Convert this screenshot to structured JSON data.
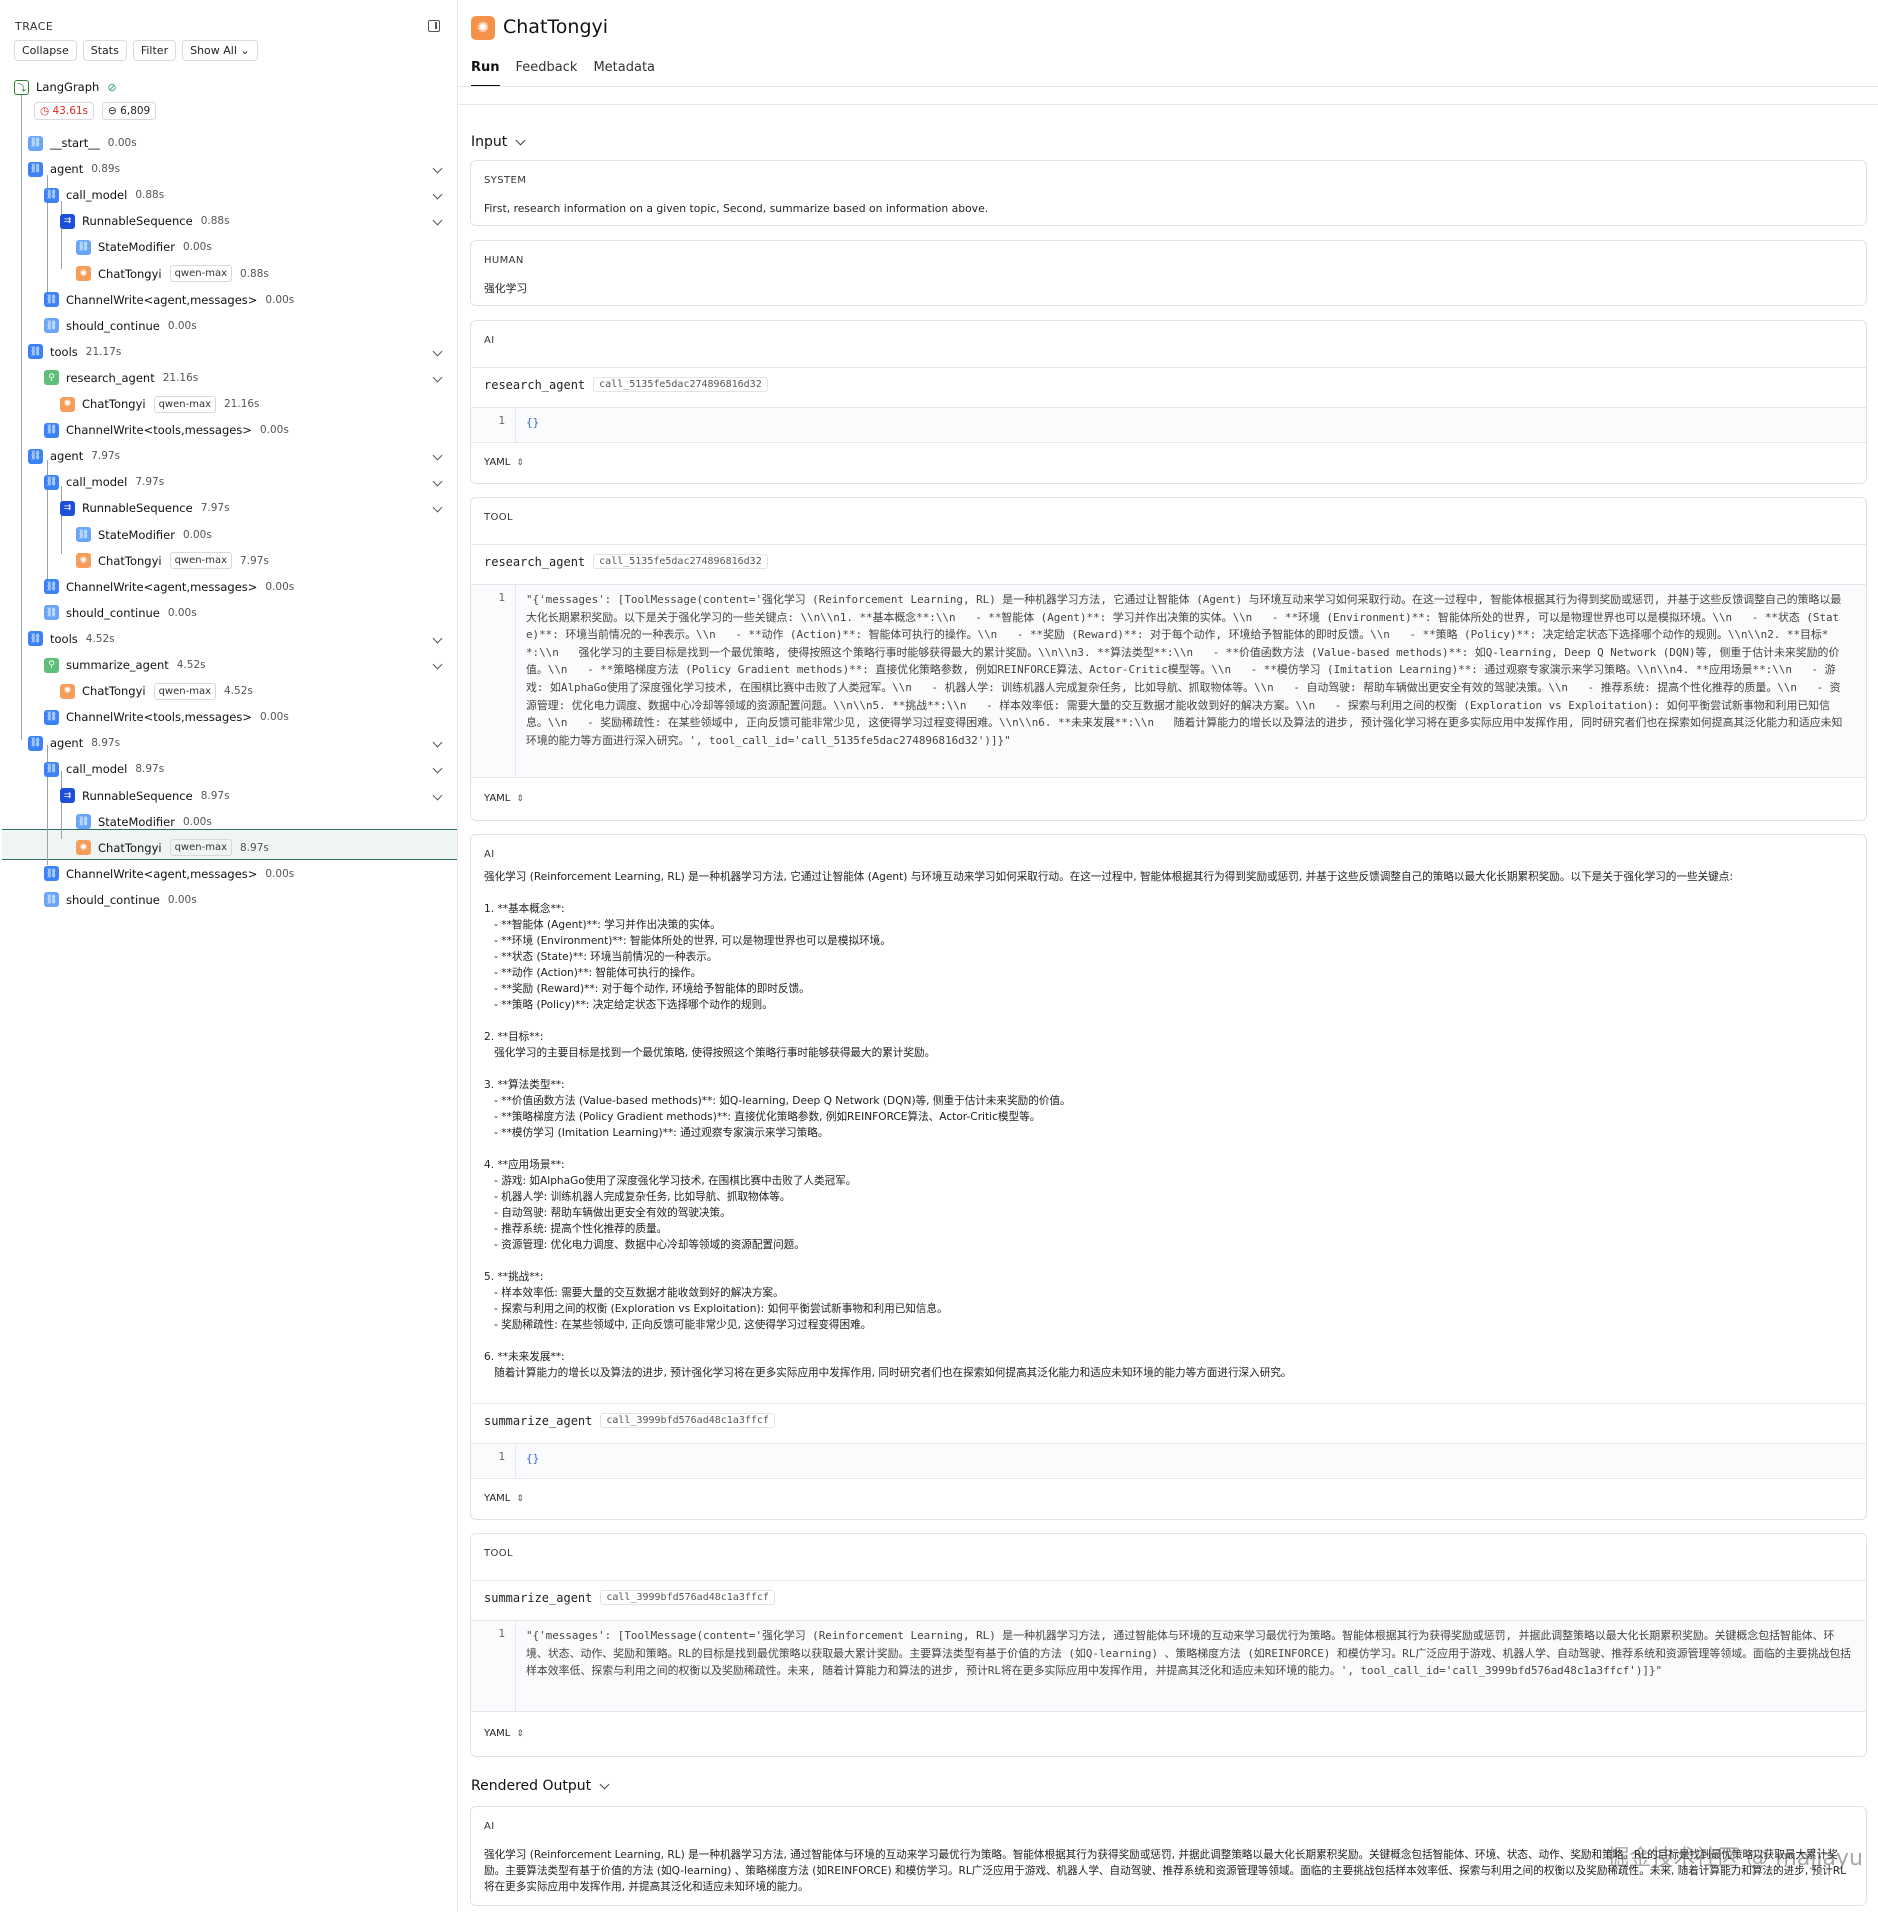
{
  "trace": {
    "header": "TRACE",
    "toolbar": {
      "collapse": "Collapse",
      "stats": "Stats",
      "filter": "Filter",
      "show_all": "Show All"
    },
    "root": {
      "label": "LangGraph",
      "latency": "43.61s",
      "tokens": "6,809"
    },
    "nodes": [
      {
        "label": "__start__",
        "dur": "0.00s"
      },
      {
        "label": "agent",
        "dur": "0.89s"
      },
      {
        "label": "call_model",
        "dur": "0.88s"
      },
      {
        "label": "RunnableSequence",
        "dur": "0.88s"
      },
      {
        "label": "StateModifier",
        "dur": "0.00s"
      },
      {
        "label": "ChatTongyi",
        "tag": "qwen-max",
        "dur": "0.88s"
      },
      {
        "label": "ChannelWrite<agent,messages>",
        "dur": "0.00s"
      },
      {
        "label": "should_continue",
        "dur": "0.00s"
      },
      {
        "label": "tools",
        "dur": "21.17s"
      },
      {
        "label": "research_agent",
        "dur": "21.16s"
      },
      {
        "label": "ChatTongyi",
        "tag": "qwen-max",
        "dur": "21.16s"
      },
      {
        "label": "ChannelWrite<tools,messages>",
        "dur": "0.00s"
      },
      {
        "label": "agent",
        "dur": "7.97s"
      },
      {
        "label": "call_model",
        "dur": "7.97s"
      },
      {
        "label": "RunnableSequence",
        "dur": "7.97s"
      },
      {
        "label": "StateModifier",
        "dur": "0.00s"
      },
      {
        "label": "ChatTongyi",
        "tag": "qwen-max",
        "dur": "7.97s"
      },
      {
        "label": "ChannelWrite<agent,messages>",
        "dur": "0.00s"
      },
      {
        "label": "should_continue",
        "dur": "0.00s"
      },
      {
        "label": "tools",
        "dur": "4.52s"
      },
      {
        "label": "summarize_agent",
        "dur": "4.52s"
      },
      {
        "label": "ChatTongyi",
        "tag": "qwen-max",
        "dur": "4.52s"
      },
      {
        "label": "ChannelWrite<tools,messages>",
        "dur": "0.00s"
      },
      {
        "label": "agent",
        "dur": "8.97s"
      },
      {
        "label": "call_model",
        "dur": "8.97s"
      },
      {
        "label": "RunnableSequence",
        "dur": "8.97s"
      },
      {
        "label": "StateModifier",
        "dur": "0.00s"
      },
      {
        "label": "ChatTongyi",
        "tag": "qwen-max",
        "dur": "8.97s"
      },
      {
        "label": "ChannelWrite<agent,messages>",
        "dur": "0.00s"
      },
      {
        "label": "should_continue",
        "dur": "0.00s"
      }
    ]
  },
  "detail": {
    "title": "ChatTongyi",
    "tabs": [
      "Run",
      "Feedback",
      "Metadata"
    ],
    "input_label": "Input",
    "rendered_label": "Rendered Output",
    "system": {
      "role": "SYSTEM",
      "text": "First, research information on a given topic, Second, summarize based on information above."
    },
    "human": {
      "role": "HUMAN",
      "text": "强化学习"
    },
    "ai1": {
      "role": "AI",
      "fn": "research_agent",
      "call_id": "call_5135fe5dac274896816d32",
      "line": "1",
      "args": "{}",
      "yaml": "YAML"
    },
    "tool1": {
      "role": "TOOL",
      "fn": "research_agent",
      "call_id": "call_5135fe5dac274896816d32",
      "line": "1",
      "content": "\"{'messages': [ToolMessage(content='强化学习 (Reinforcement Learning, RL) 是一种机器学习方法, 它通过让智能体 (Agent) 与环境互动来学习如何采取行动。在这一过程中, 智能体根据其行为得到奖励或惩罚, 并基于这些反馈调整自己的策略以最大化长期累积奖励。以下是关于强化学习的一些关键点: \\\\n\\\\n1. **基本概念**:\\\\n   - **智能体 (Agent)**: 学习并作出决策的实体。\\\\n   - **环境 (Environment)**: 智能体所处的世界, 可以是物理世界也可以是模拟环境。\\\\n   - **状态 (State)**: 环境当前情况的一种表示。\\\\n   - **动作 (Action)**: 智能体可执行的操作。\\\\n   - **奖励 (Reward)**: 对于每个动作, 环境给予智能体的即时反馈。\\\\n   - **策略 (Policy)**: 决定给定状态下选择哪个动作的规则。\\\\n\\\\n2. **目标**:\\\\n   强化学习的主要目标是找到一个最优策略, 使得按照这个策略行事时能够获得最大的累计奖励。\\\\n\\\\n3. **算法类型**:\\\\n   - **价值函数方法 (Value-based methods)**: 如Q-learning, Deep Q Network (DQN)等, 侧重于估计未来奖励的价值。\\\\n   - **策略梯度方法 (Policy Gradient methods)**: 直接优化策略参数, 例如REINFORCE算法、Actor-Critic模型等。\\\\n   - **模仿学习 (Imitation Learning)**: 通过观察专家演示来学习策略。\\\\n\\\\n4. **应用场景**:\\\\n   - 游戏: 如AlphaGo使用了深度强化学习技术, 在围棋比赛中击败了人类冠军。\\\\n   - 机器人学: 训练机器人完成复杂任务, 比如导航、抓取物体等。\\\\n   - 自动驾驶: 帮助车辆做出更安全有效的驾驶决策。\\\\n   - 推荐系统: 提高个性化推荐的质量。\\\\n   - 资源管理: 优化电力调度、数据中心冷却等领域的资源配置问题。\\\\n\\\\n5. **挑战**:\\\\n   - 样本效率低: 需要大量的交互数据才能收敛到好的解决方案。\\\\n   - 探索与利用之间的权衡 (Exploration vs Exploitation): 如何平衡尝试新事物和利用已知信息。\\\\n   - 奖励稀疏性: 在某些领域中, 正向反馈可能非常少见, 这使得学习过程变得困难。\\\\n\\\\n6. **未来发展**:\\\\n   随着计算能力的增长以及算法的进步, 预计强化学习将在更多实际应用中发挥作用, 同时研究者们也在探索如何提高其泛化能力和适应未知环境的能力等方面进行深入研究。', tool_call_id='call_5135fe5dac274896816d32')]}\"",
      "yaml": "YAML"
    },
    "ai2": {
      "role": "AI",
      "text": "强化学习 (Reinforcement Learning, RL) 是一种机器学习方法, 它通过让智能体 (Agent) 与环境互动来学习如何采取行动。在这一过程中, 智能体根据其行为得到奖励或惩罚, 并基于这些反馈调整自己的策略以最大化长期累积奖励。以下是关于强化学习的一些关键点:\n\n1. **基本概念**:\n   - **智能体 (Agent)**: 学习并作出决策的实体。\n   - **环境 (Environment)**: 智能体所处的世界, 可以是物理世界也可以是模拟环境。\n   - **状态 (State)**: 环境当前情况的一种表示。\n   - **动作 (Action)**: 智能体可执行的操作。\n   - **奖励 (Reward)**: 对于每个动作, 环境给予智能体的即时反馈。\n   - **策略 (Policy)**: 决定给定状态下选择哪个动作的规则。\n\n2. **目标**:\n   强化学习的主要目标是找到一个最优策略, 使得按照这个策略行事时能够获得最大的累计奖励。\n\n3. **算法类型**:\n   - **价值函数方法 (Value-based methods)**: 如Q-learning, Deep Q Network (DQN)等, 侧重于估计未来奖励的价值。\n   - **策略梯度方法 (Policy Gradient methods)**: 直接优化策略参数, 例如REINFORCE算法、Actor-Critic模型等。\n   - **模仿学习 (Imitation Learning)**: 通过观察专家演示来学习策略。\n\n4. **应用场景**:\n   - 游戏: 如AlphaGo使用了深度强化学习技术, 在围棋比赛中击败了人类冠军。\n   - 机器人学: 训练机器人完成复杂任务, 比如导航、抓取物体等。\n   - 自动驾驶: 帮助车辆做出更安全有效的驾驶决策。\n   - 推荐系统: 提高个性化推荐的质量。\n   - 资源管理: 优化电力调度、数据中心冷却等领域的资源配置问题。\n\n5. **挑战**:\n   - 样本效率低: 需要大量的交互数据才能收敛到好的解决方案。\n   - 探索与利用之间的权衡 (Exploration vs Exploitation): 如何平衡尝试新事物和利用已知信息。\n   - 奖励稀疏性: 在某些领域中, 正向反馈可能非常少见, 这使得学习过程变得困难。\n\n6. **未来发展**:\n   随着计算能力的增长以及算法的进步, 预计强化学习将在更多实际应用中发挥作用, 同时研究者们也在探索如何提高其泛化能力和适应未知环境的能力等方面进行深入研究。",
      "fn": "summarize_agent",
      "call_id": "call_3999bfd576ad48c1a3ffcf",
      "line": "1",
      "args": "{}",
      "yaml": "YAML"
    },
    "tool2": {
      "role": "TOOL",
      "fn": "summarize_agent",
      "call_id": "call_3999bfd576ad48c1a3ffcf",
      "line": "1",
      "content": "\"{'messages': [ToolMessage(content='强化学习 (Reinforcement Learning, RL) 是一种机器学习方法, 通过智能体与环境的互动来学习最优行为策略。智能体根据其行为获得奖励或惩罚, 并据此调整策略以最大化长期累积奖励。关键概念包括智能体、环境、状态、动作、奖励和策略。RL的目标是找到最优策略以获取最大累计奖励。主要算法类型有基于价值的方法 (如Q-learning) 、策略梯度方法 (如REINFORCE) 和模仿学习。RL广泛应用于游戏、机器人学、自动驾驶、推荐系统和资源管理等领域。面临的主要挑战包括样本效率低、探索与利用之间的权衡以及奖励稀疏性。未来, 随着计算能力和算法的进步, 预计RL将在更多实际应用中发挥作用, 并提高其泛化和适应未知环境的能力。', tool_call_id='call_3999bfd576ad48c1a3ffcf')]}\"",
      "yaml": "YAML"
    },
    "rendered": {
      "role": "AI",
      "text": "强化学习 (Reinforcement Learning, RL) 是一种机器学习方法, 通过智能体与环境的互动来学习最优行为策略。智能体根据其行为获得奖励或惩罚, 并据此调整策略以最大化长期累积奖励。关键概念包括智能体、环境、状态、动作、奖励和策略。RL的目标是找到最优策略以获取最大累计奖励。主要算法类型有基于价值的方法 (如Q-learning) 、策略梯度方法 (如REINFORCE) 和模仿学习。RL广泛应用于游戏、机器人学、自动驾驶、推荐系统和资源管理等领域。面临的主要挑战包括样本效率低、探索与利用之间的权衡以及奖励稀疏性。未来, 随着计算能力和算法的进步, 预计RL将在更多实际应用中发挥作用, 并提高其泛化和适应未知环境的能力。"
    },
    "watermark": "掘金技术社区 @ majiayu"
  }
}
